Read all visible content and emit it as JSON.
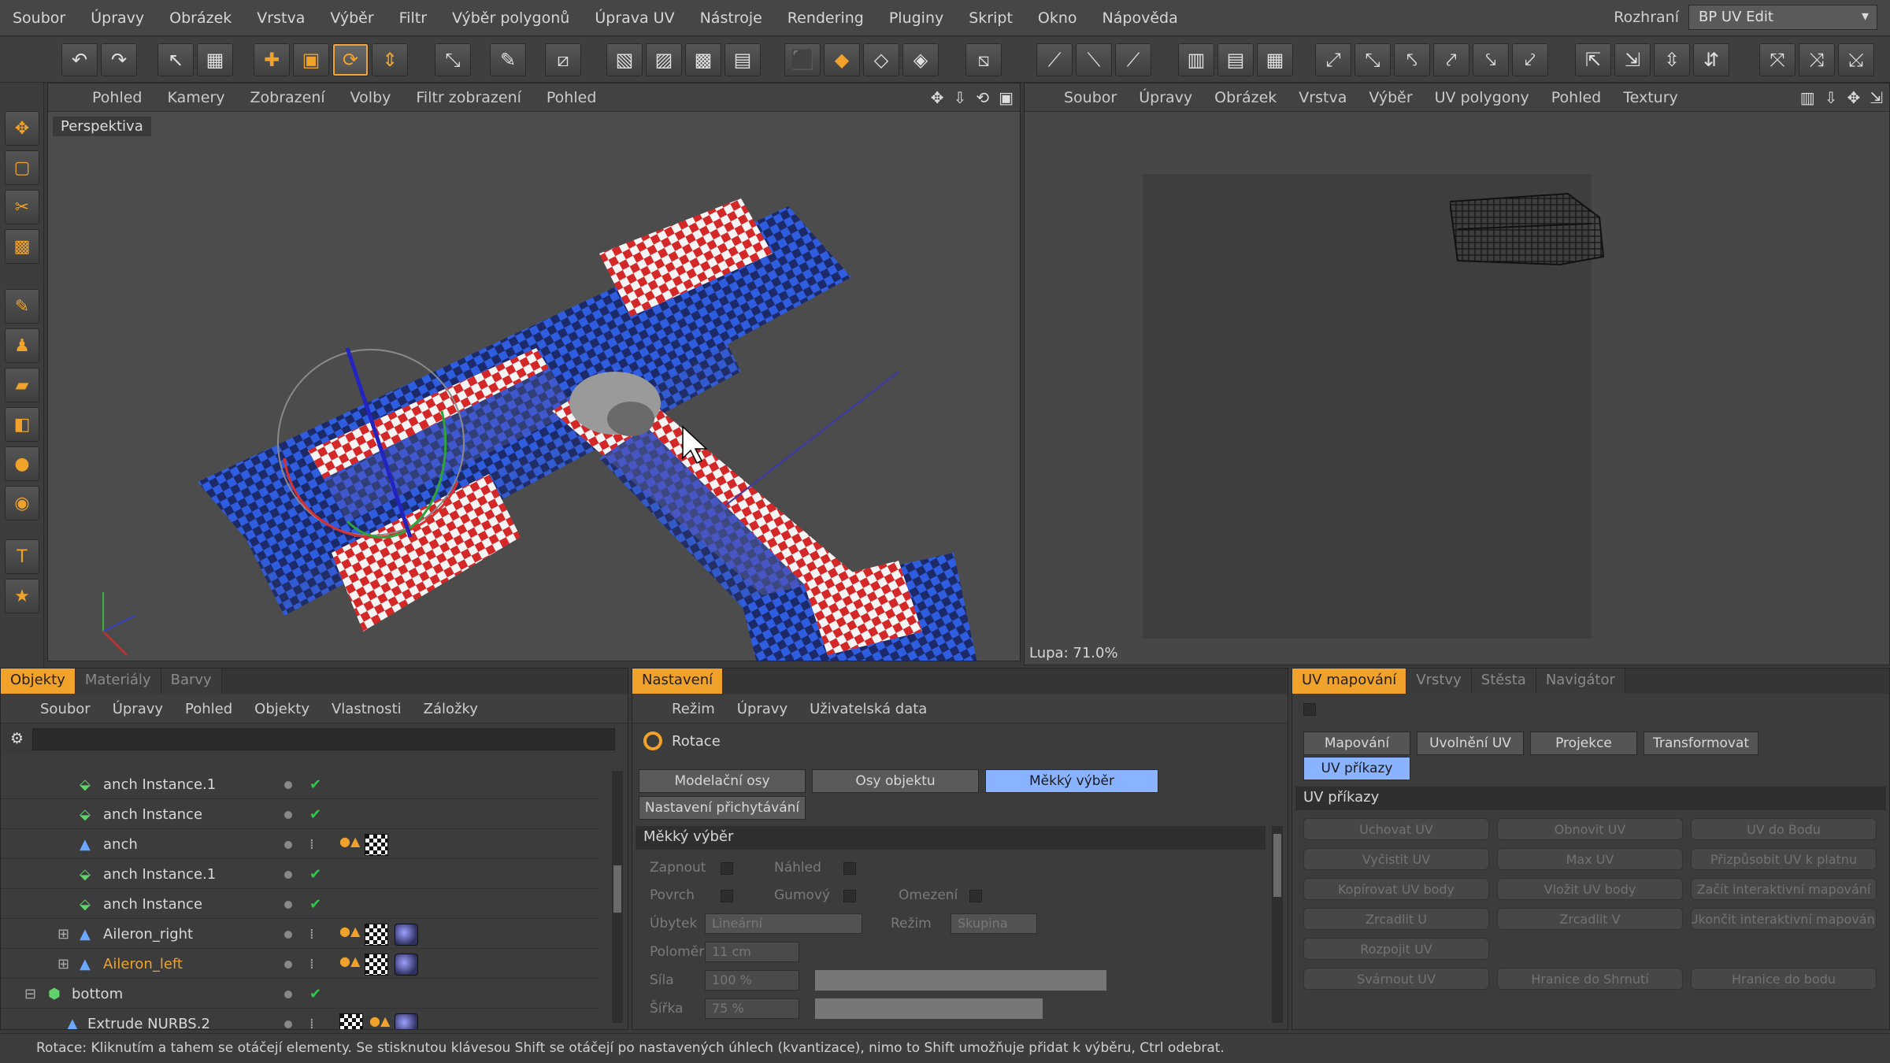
{
  "menubar": {
    "items": [
      "Soubor",
      "Úpravy",
      "Obrázek",
      "Vrstva",
      "Výběr",
      "Filtr",
      "Výběr polygonů",
      "Úprava UV",
      "Nástroje",
      "Rendering",
      "Pluginy",
      "Skript",
      "Okno",
      "Nápověda"
    ],
    "interface_label": "Rozhraní",
    "interface_value": "BP UV Edit"
  },
  "viewport": {
    "menu": [
      "Pohled",
      "Kamery",
      "Zobrazení",
      "Volby",
      "Filtr zobrazení",
      "Pohled"
    ],
    "label": "Perspektiva"
  },
  "uv_view": {
    "menu": [
      "Soubor",
      "Úpravy",
      "Obrázek",
      "Vrstva",
      "Výběr",
      "UV polygony",
      "Pohled",
      "Textury"
    ],
    "zoom": "Lupa: 71.0%"
  },
  "objects": {
    "tabs": [
      "Objekty",
      "Materiály",
      "Barvy"
    ],
    "menu": [
      "Soubor",
      "Úpravy",
      "Pohled",
      "Objekty",
      "Vlastnosti",
      "Záložky"
    ],
    "rows": [
      {
        "name": "anch Instance.1",
        "highlight": false
      },
      {
        "name": "anch Instance",
        "highlight": false
      },
      {
        "name": "anch",
        "highlight": false
      },
      {
        "name": "anch Instance.1",
        "highlight": false
      },
      {
        "name": "anch Instance",
        "highlight": false
      },
      {
        "name": "Aileron_right",
        "highlight": false
      },
      {
        "name": "Aileron_left",
        "highlight": true
      },
      {
        "name": "bottom",
        "highlight": false
      },
      {
        "name": "Extrude NURBS.2",
        "highlight": false
      }
    ]
  },
  "settings": {
    "tab": "Nastavení",
    "menu": [
      "Režim",
      "Úpravy",
      "Uživatelská data"
    ],
    "tool": "Rotace",
    "buttons": [
      "Modelační osy",
      "Osy objektu",
      "Měkký výběr"
    ],
    "snap_button": "Nastavení přichytávání",
    "section": "Měkký výběr",
    "props": {
      "enable": "Zapnout",
      "preview": "Náhled",
      "surface": "Povrch",
      "rubber": "Gumový",
      "restrict": "Omezení",
      "falloff": "Úbytek",
      "falloff_value": "Lineární",
      "mode": "Režim",
      "mode_value": "Skupina",
      "radius": "Poloměr",
      "radius_value": "11 cm",
      "strength": "Síla",
      "strength_value": "100 %",
      "width": "Šířka",
      "width_value": "75 %"
    },
    "strength_fill": 1.0,
    "width_fill": 0.78
  },
  "uv_mapping": {
    "tabs": [
      "UV mapování",
      "Vrstvy",
      "Stěsta",
      "Navigátor"
    ],
    "buttons": [
      "Mapování",
      "Uvolnění UV",
      "Projekce",
      "Transformovat"
    ],
    "active_button": "UV příkazy",
    "section": "UV příkazy",
    "commands": [
      "Uchovat UV",
      "Obnovit UV",
      "UV do Bodu",
      "Vyčistit UV",
      "Max UV",
      "Přizpůsobit UV k platnu",
      "Kopírovat UV body",
      "Vložit UV body",
      "Začít interaktivní mapování",
      "Zrcadlit U",
      "Zrcadlit V",
      "Ukončit interaktivní mapování",
      "Rozpojit UV",
      "",
      "",
      "Svárnout UV",
      "Hranice do Shrnutí",
      "Hranice do bodu"
    ]
  },
  "status": "Rotace: Kliknutím a tahem se otáčejí elementy. Se stisknutou klávesou Shift se otáčejí po nastavených úhlech (kvantizace), nimo to Shift umožňuje přidat k výběru, Ctrl odebrat."
}
